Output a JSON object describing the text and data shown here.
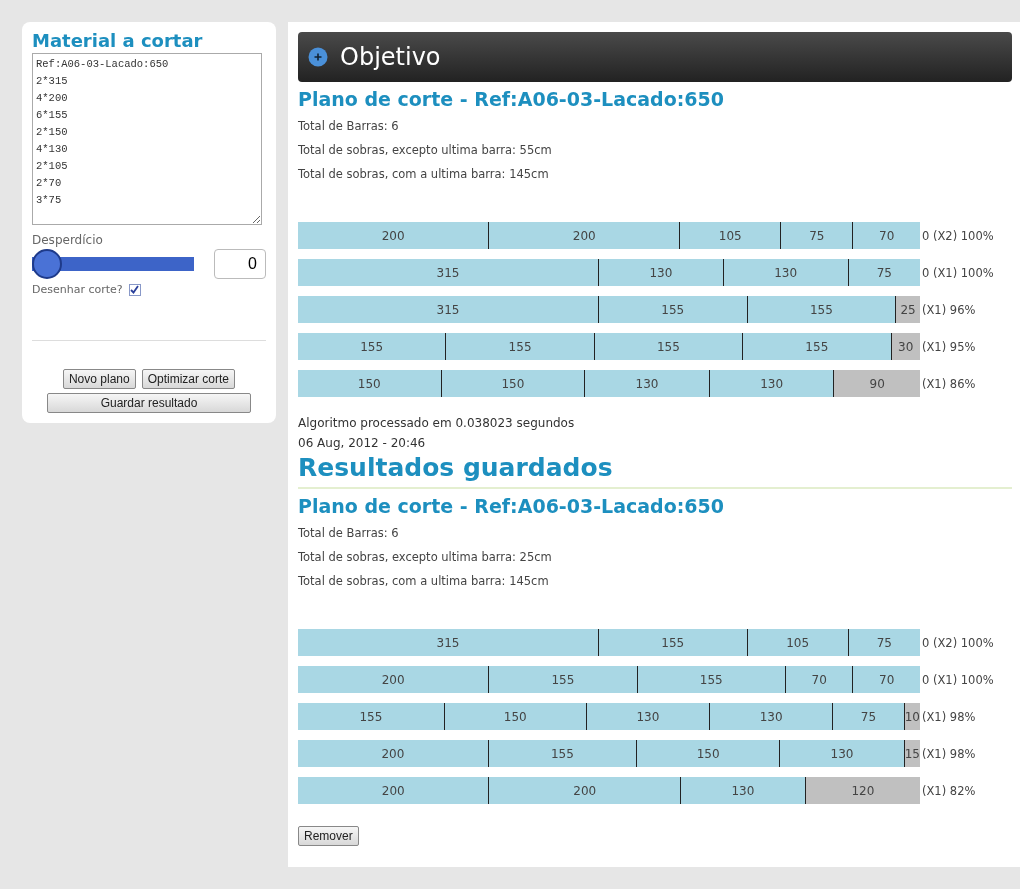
{
  "sidebar": {
    "title": "Material a cortar",
    "material_text": "Ref:A06-03-Lacado:650\n2*315\n4*200\n6*155\n2*150\n4*130\n2*105\n2*70\n3*75",
    "waste_label": "Desperdício",
    "waste_slider": {
      "level": 0
    },
    "waste_value": "0",
    "draw_cut": {
      "label": "Desenhar corte?",
      "checked": true
    },
    "buttons": [
      "Novo plano",
      "Optimizar corte"
    ],
    "save_button": "Guardar resultado"
  },
  "header": {
    "title": "Objetivo"
  },
  "plans": [
    {
      "kind": "current",
      "title": "Plano de corte - Ref:A06-03-Lacado:650",
      "stats": [
        "Total de Barras: 6",
        "Total de sobras, excepto ultima barra: 55cm",
        "Total de sobras, com a ultima barra: 145cm"
      ],
      "bars": [
        {
          "segments": [
            {
              "kind": "piece",
              "text": "200"
            },
            {
              "kind": "piece",
              "text": "200"
            },
            {
              "kind": "piece",
              "text": "105"
            },
            {
              "kind": "piece",
              "text": "75"
            },
            {
              "kind": "piece",
              "text": "70"
            }
          ],
          "label": "0 (X2) 100%"
        },
        {
          "segments": [
            {
              "kind": "piece",
              "text": "315"
            },
            {
              "kind": "piece",
              "text": "130"
            },
            {
              "kind": "piece",
              "text": "130"
            },
            {
              "kind": "piece",
              "text": "75"
            }
          ],
          "label": "0 (X1) 100%"
        },
        {
          "segments": [
            {
              "kind": "piece",
              "text": "315"
            },
            {
              "kind": "piece",
              "text": "155"
            },
            {
              "kind": "piece",
              "text": "155"
            },
            {
              "kind": "waste",
              "text": "25"
            }
          ],
          "label": "(X1) 96%"
        },
        {
          "segments": [
            {
              "kind": "piece",
              "text": "155"
            },
            {
              "kind": "piece",
              "text": "155"
            },
            {
              "kind": "piece",
              "text": "155"
            },
            {
              "kind": "piece",
              "text": "155"
            },
            {
              "kind": "waste",
              "text": "30"
            }
          ],
          "label": "(X1) 95%"
        },
        {
          "segments": [
            {
              "kind": "piece",
              "text": "150"
            },
            {
              "kind": "piece",
              "text": "150"
            },
            {
              "kind": "piece",
              "text": "130"
            },
            {
              "kind": "piece",
              "text": "130"
            },
            {
              "kind": "waste",
              "text": "90"
            }
          ],
          "label": "(X1) 86%"
        }
      ],
      "footer": [
        "Algoritmo processado em 0.038023 segundos",
        "06 Aug, 2012 - 20:46"
      ]
    },
    {
      "kind": "saved",
      "heading": "Resultados guardados",
      "title": "Plano de corte - Ref:A06-03-Lacado:650",
      "stats": [
        "Total de Barras: 6",
        "Total de sobras, excepto ultima barra: 25cm",
        "Total de sobras, com a ultima barra: 145cm"
      ],
      "bars": [
        {
          "segments": [
            {
              "kind": "piece",
              "text": "315"
            },
            {
              "kind": "piece",
              "text": "155"
            },
            {
              "kind": "piece",
              "text": "105"
            },
            {
              "kind": "piece",
              "text": "75"
            }
          ],
          "label": "0 (X2) 100%"
        },
        {
          "segments": [
            {
              "kind": "piece",
              "text": "200"
            },
            {
              "kind": "piece",
              "text": "155"
            },
            {
              "kind": "piece",
              "text": "155"
            },
            {
              "kind": "piece",
              "text": "70"
            },
            {
              "kind": "piece",
              "text": "70"
            }
          ],
          "label": "0 (X1) 100%"
        },
        {
          "segments": [
            {
              "kind": "piece",
              "text": "155"
            },
            {
              "kind": "piece",
              "text": "150"
            },
            {
              "kind": "piece",
              "text": "130"
            },
            {
              "kind": "piece",
              "text": "130"
            },
            {
              "kind": "piece",
              "text": "75"
            },
            {
              "kind": "waste",
              "text": "10"
            }
          ],
          "label": "(X1) 98%"
        },
        {
          "segments": [
            {
              "kind": "piece",
              "text": "200"
            },
            {
              "kind": "piece",
              "text": "155"
            },
            {
              "kind": "piece",
              "text": "150"
            },
            {
              "kind": "piece",
              "text": "130"
            },
            {
              "kind": "waste",
              "text": "15"
            }
          ],
          "label": "(X1) 98%"
        },
        {
          "segments": [
            {
              "kind": "piece",
              "text": "200"
            },
            {
              "kind": "piece",
              "text": "200"
            },
            {
              "kind": "piece",
              "text": "130"
            },
            {
              "kind": "waste",
              "text": "120"
            }
          ],
          "label": "(X1) 82%"
        }
      ],
      "remove_button": "Remover"
    }
  ]
}
